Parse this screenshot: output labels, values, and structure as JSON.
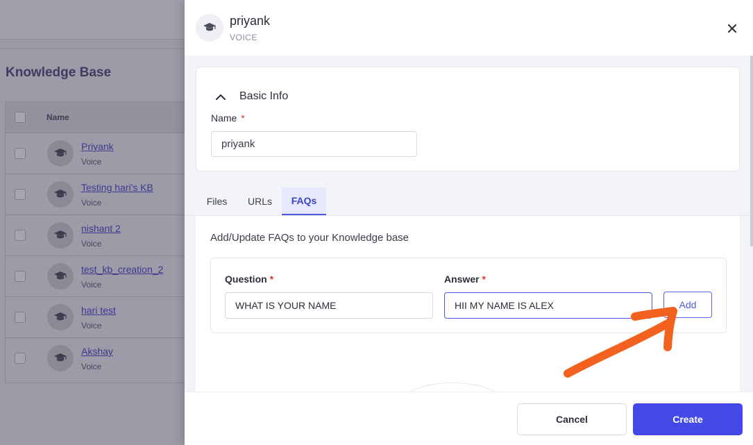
{
  "background": {
    "page_title": "Knowledge Base",
    "table_header": "Name",
    "rows": [
      {
        "name": "Priyank",
        "type": "Voice"
      },
      {
        "name": "Testing hari's KB",
        "type": "Voice"
      },
      {
        "name": "nishant 2",
        "type": "Voice"
      },
      {
        "name": "test_kb_creation_2",
        "type": "Voice"
      },
      {
        "name": "hari test",
        "type": "Voice"
      },
      {
        "name": "Akshay",
        "type": "Voice"
      }
    ]
  },
  "drawer": {
    "title": "priyank",
    "subtitle": "VOICE",
    "close_icon": "close-icon",
    "basic_info": {
      "heading": "Basic Info",
      "name_label": "Name",
      "required_mark": "*",
      "name_value": "priyank"
    },
    "tabs": [
      {
        "label": "Files",
        "active": false
      },
      {
        "label": "URLs",
        "active": false
      },
      {
        "label": "FAQs",
        "active": true
      }
    ],
    "faq": {
      "heading": "Add/Update FAQs to your Knowledge base",
      "question_label": "Question",
      "answer_label": "Answer",
      "required_mark": "*",
      "question_value": "WHAT IS YOUR NAME",
      "answer_value": "HII MY NAME IS ALEX",
      "add_label": "Add"
    },
    "footer": {
      "cancel_label": "Cancel",
      "create_label": "Create"
    }
  },
  "colors": {
    "accent": "#4448e6",
    "annotation_arrow": "#f2611d",
    "overlay": "#9b9aa6"
  }
}
